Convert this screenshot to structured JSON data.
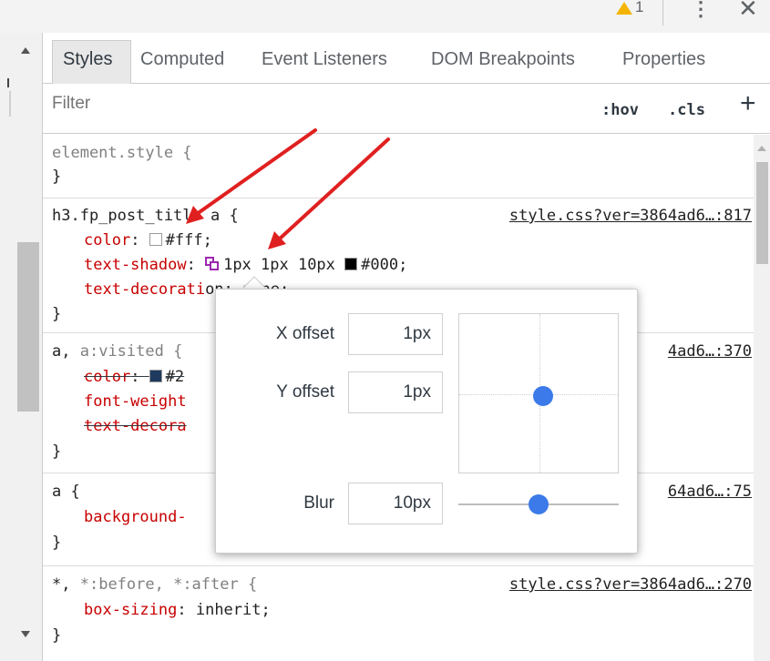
{
  "topbar": {
    "warning_count": "1",
    "kebab_glyph": "⋮",
    "close_glyph": "✕"
  },
  "tabs": [
    {
      "label": "Styles",
      "active": true
    },
    {
      "label": "Computed",
      "active": false
    },
    {
      "label": "Event Listeners",
      "active": false
    },
    {
      "label": "DOM Breakpoints",
      "active": false
    },
    {
      "label": "Properties",
      "active": false
    }
  ],
  "filter": {
    "placeholder": "Filter",
    "hov": ":hov",
    "cls": ".cls",
    "add": "+"
  },
  "rules": {
    "element_style": {
      "selector": "element.style {",
      "close": "}"
    },
    "h3_rule": {
      "selector": "h3.fp_post_title a {",
      "source": "style.css?ver=3864ad6…:817",
      "color_prop": "color",
      "color_val": "#fff;",
      "color_swatch": "#ffffff",
      "shadow_prop": "text-shadow",
      "shadow_val_a": "1px 1px 10px",
      "shadow_val_b": "#000;",
      "shadow_swatch": "#000000",
      "decoration_prop": "text-decorati",
      "decoration_val": "on: none;",
      "close": "}"
    },
    "a_visited_rule": {
      "selector_a": "a,",
      "selector_b": "a:visited {",
      "source": "4ad6…:370",
      "color_prop": "color",
      "color_val": "#2",
      "color_swatch": "#1e3a5f",
      "weight_prop": "font-weight",
      "decoration_prop": "text-decora",
      "close": "}"
    },
    "a_rule": {
      "selector": "a {",
      "source": "64ad6…:75",
      "background_prop": "background-",
      "close": "}"
    },
    "universal_rule": {
      "selector_a": "*,",
      "selector_b": "*:before, *:after {",
      "source": "style.css?ver=3864ad6…:270",
      "box_prop": "box-sizing",
      "box_val": "inherit;",
      "close": "}"
    }
  },
  "shadow_editor": {
    "x_label": "X offset",
    "x_value": "1px",
    "y_label": "Y offset",
    "y_value": "1px",
    "blur_label": "Blur",
    "blur_value": "10px",
    "pad_x_fraction": 0.53,
    "pad_y_fraction": 0.52,
    "blur_fraction": 0.5,
    "accent_color": "#3b7ae8"
  },
  "annotation_color": "#e02020"
}
